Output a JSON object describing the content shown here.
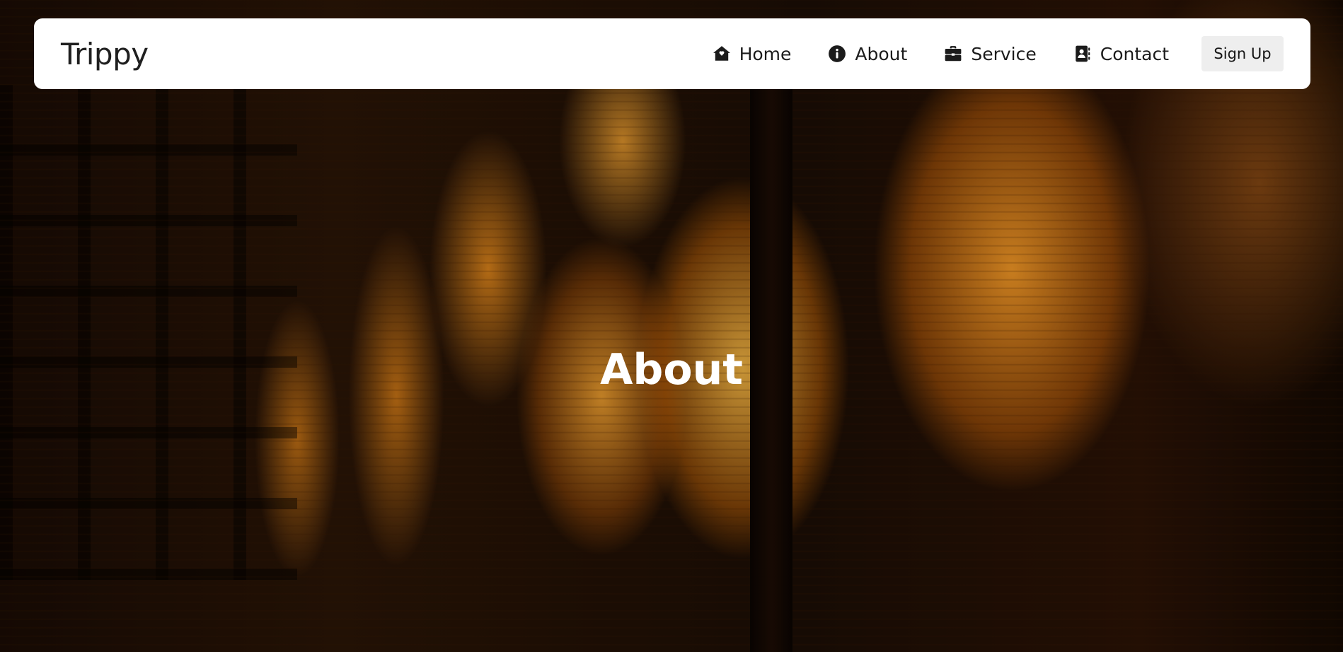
{
  "brand": "Trippy",
  "nav": {
    "items": [
      {
        "label": "Home",
        "icon": "home-icon"
      },
      {
        "label": "About",
        "icon": "info-icon"
      },
      {
        "label": "Service",
        "icon": "briefcase-icon"
      },
      {
        "label": "Contact",
        "icon": "contact-book-icon"
      }
    ],
    "signup_label": "Sign Up"
  },
  "hero": {
    "title": "About"
  },
  "colors": {
    "navbar_bg": "#ffffff",
    "text": "#1b1b1b",
    "button_bg": "#eeeeee",
    "hero_title": "#ffffff",
    "lantern_glow": "#f5a028"
  }
}
